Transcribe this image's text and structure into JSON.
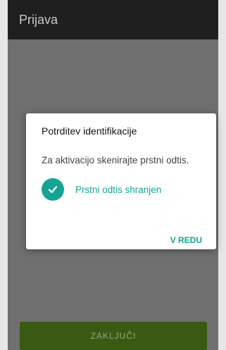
{
  "app_bar": {
    "title": "Prijava"
  },
  "main": {
    "finish_label": "ZAKLJUČI"
  },
  "dialog": {
    "title": "Potrditev identifikacije",
    "message": "Za aktivacijo skenirajte prstni odtis.",
    "status_text": "Prstni odtis shranjen",
    "status_icon": "checkmark-icon",
    "ok_label": "V REDU"
  },
  "colors": {
    "accent": "#16a394",
    "app_bar": "#1f1f1f",
    "primary_button": "#3a5a14"
  }
}
